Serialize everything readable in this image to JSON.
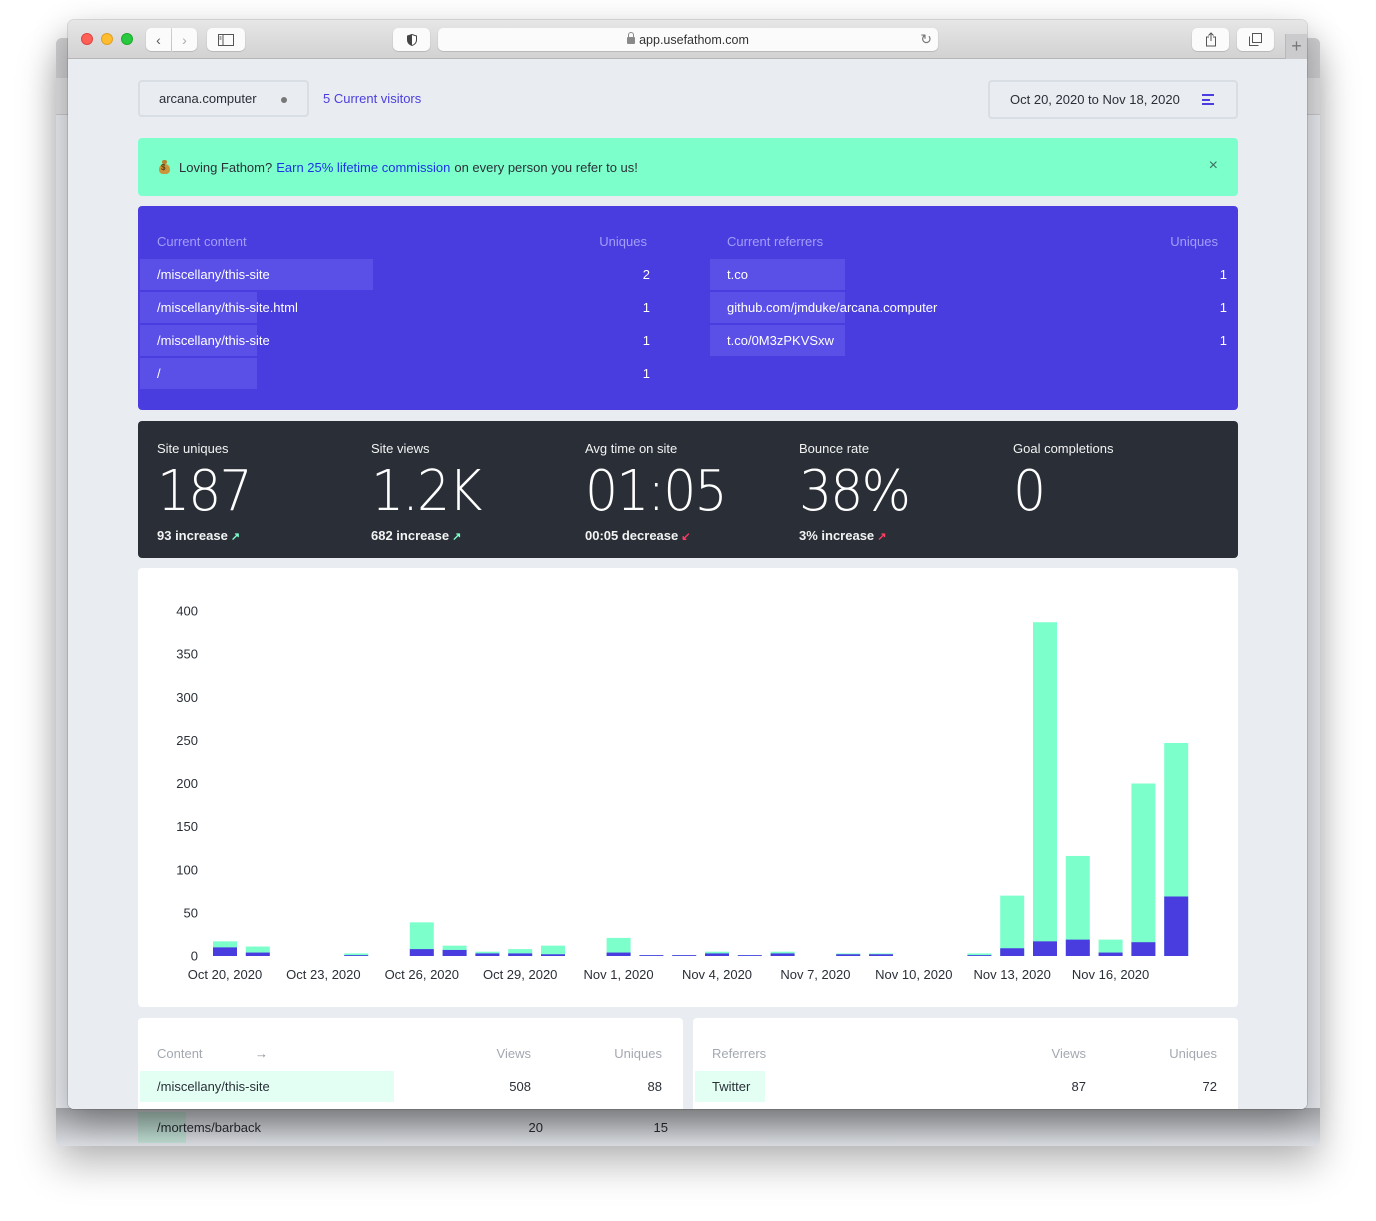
{
  "browser": {
    "url": "app.usefathom.com",
    "new_tab_label": "+"
  },
  "header": {
    "site_name": "arcana.computer",
    "current_visitors": "5 Current visitors",
    "date_range": "Oct 20, 2020 to Nov 18, 2020"
  },
  "banner": {
    "prefix": "Loving Fathom?",
    "link": "Earn 25% lifetime commission",
    "suffix": "on every person you refer to us!",
    "close": "×"
  },
  "realtime": {
    "content": {
      "header": "Current content",
      "col": "Uniques",
      "rows": [
        {
          "label": "/miscellany/this-site",
          "value": "2",
          "share": 1.0
        },
        {
          "label": "/miscellany/this-site.html",
          "value": "1",
          "share": 0.5
        },
        {
          "label": "/miscellany/this-site",
          "value": "1",
          "share": 0.5
        },
        {
          "label": "/",
          "value": "1",
          "share": 0.5
        }
      ]
    },
    "referrers": {
      "header": "Current referrers",
      "col": "Uniques",
      "rows": [
        {
          "label": "t.co",
          "value": "1",
          "share": 0.25
        },
        {
          "label": "github.com/jmduke/arcana.computer",
          "value": "1",
          "share": 0.25
        },
        {
          "label": "t.co/0M3zPKVSxw",
          "value": "1",
          "share": 0.25
        }
      ]
    }
  },
  "stats": [
    {
      "label": "Site uniques",
      "value": "187",
      "change": "93 increase",
      "trend": "up-good"
    },
    {
      "label": "Site views",
      "value": "1.2K",
      "change": "682 increase",
      "trend": "up-good"
    },
    {
      "label": "Avg time on site",
      "value": "01:05",
      "change": "00:05 decrease",
      "trend": "down-bad"
    },
    {
      "label": "Bounce rate",
      "value": "38%",
      "change": "3% increase",
      "trend": "up-bad"
    },
    {
      "label": "Goal completions",
      "value": "0",
      "change": "",
      "trend": ""
    }
  ],
  "colors": {
    "views": "#7dffcc",
    "uniques": "#4a3de0",
    "accent": "#4b3ee0",
    "dark": "#2a2f37"
  },
  "chart_data": {
    "type": "bar",
    "stacked": true,
    "title": "",
    "xlabel": "",
    "ylabel": "",
    "ylim": [
      0,
      400
    ],
    "yticks": [
      0,
      50,
      100,
      150,
      200,
      250,
      300,
      350,
      400
    ],
    "grid": false,
    "categories": [
      "Oct 20, 2020",
      "Oct 21, 2020",
      "Oct 22, 2020",
      "Oct 23, 2020",
      "Oct 24, 2020",
      "Oct 25, 2020",
      "Oct 26, 2020",
      "Oct 27, 2020",
      "Oct 28, 2020",
      "Oct 29, 2020",
      "Oct 30, 2020",
      "Oct 31, 2020",
      "Nov 1, 2020",
      "Nov 2, 2020",
      "Nov 3, 2020",
      "Nov 4, 2020",
      "Nov 5, 2020",
      "Nov 6, 2020",
      "Nov 7, 2020",
      "Nov 8, 2020",
      "Nov 9, 2020",
      "Nov 10, 2020",
      "Nov 11, 2020",
      "Nov 12, 2020",
      "Nov 13, 2020",
      "Nov 14, 2020",
      "Nov 15, 2020",
      "Nov 16, 2020",
      "Nov 17, 2020",
      "Nov 18, 2020"
    ],
    "xtick_labels": [
      "Oct 20, 2020",
      "Oct 23, 2020",
      "Oct 26, 2020",
      "Oct 29, 2020",
      "Nov 1, 2020",
      "Nov 4, 2020",
      "Nov 7, 2020",
      "Nov 10, 2020",
      "Nov 13, 2020",
      "Nov 16, 2020"
    ],
    "series": [
      {
        "name": "Views",
        "values": [
          17,
          11,
          0,
          0,
          3,
          0,
          39,
          12,
          5,
          8,
          12,
          0,
          21,
          1,
          1,
          5,
          1,
          5,
          0,
          3,
          3,
          0,
          0,
          3,
          70,
          387,
          116,
          19,
          200,
          247
        ]
      },
      {
        "name": "Uniques",
        "values": [
          10,
          4,
          0,
          0,
          1,
          0,
          8,
          7,
          3,
          3,
          2,
          0,
          4,
          1,
          1,
          3,
          1,
          3,
          0,
          2,
          2,
          0,
          0,
          1,
          9,
          17,
          19,
          4,
          16,
          69
        ]
      }
    ]
  },
  "content_table": {
    "header": "Content",
    "arrow": "→",
    "cols": [
      "Views",
      "Uniques"
    ],
    "rows": [
      {
        "label": "/miscellany/this-site",
        "views": "508",
        "uniques": "88",
        "share": 0.47
      },
      {
        "label": "/mortems/barback",
        "views": "20",
        "uniques": "15",
        "share": 0.09
      }
    ]
  },
  "referrers_table": {
    "header": "Referrers",
    "cols": [
      "Views",
      "Uniques"
    ],
    "rows": [
      {
        "label": "Twitter",
        "views": "87",
        "uniques": "72",
        "share": 0.13
      }
    ]
  }
}
